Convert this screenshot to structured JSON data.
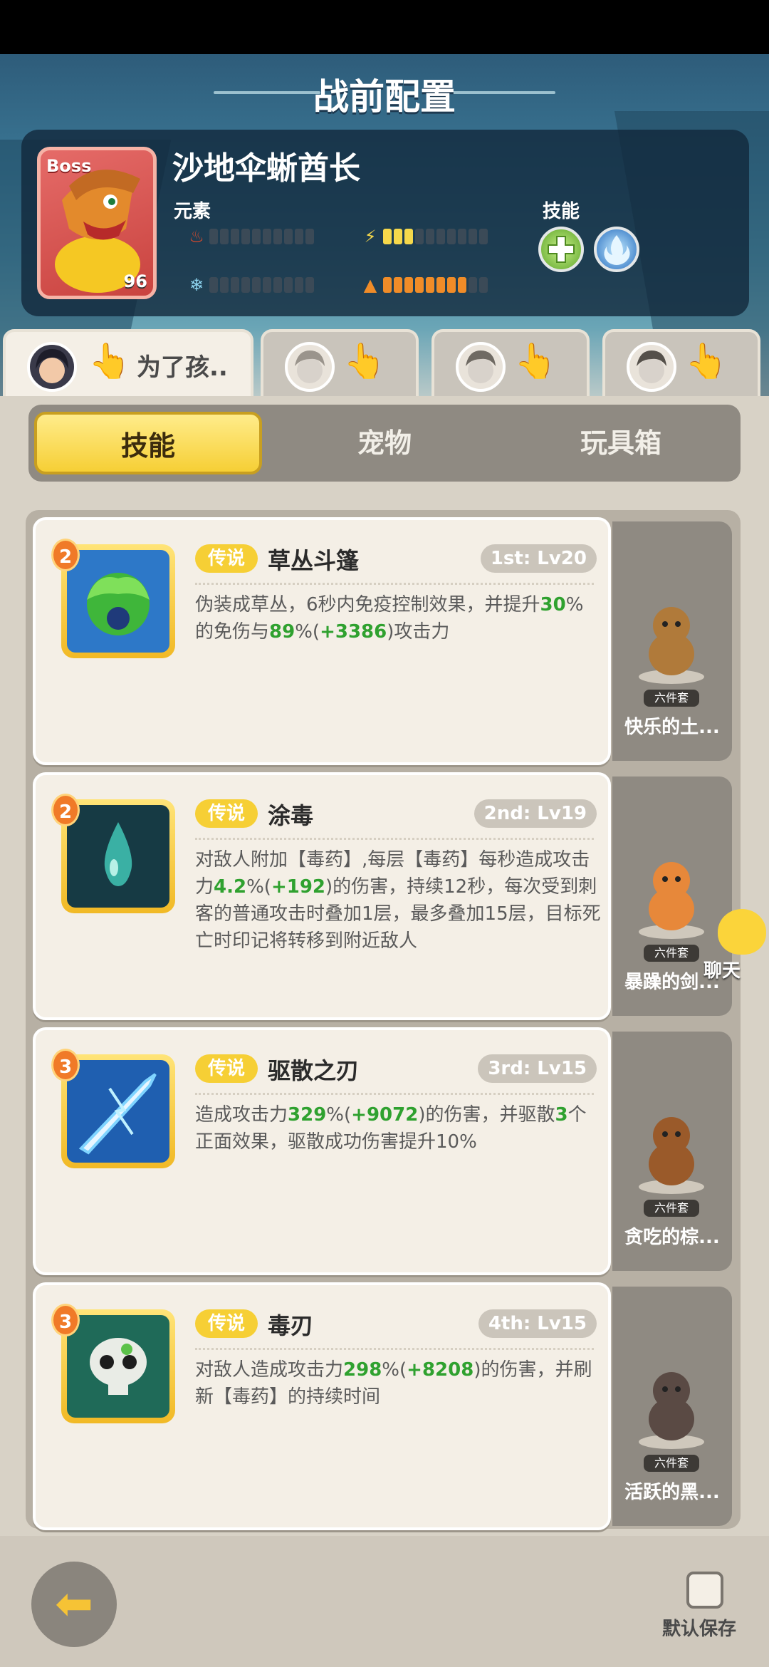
{
  "header": {
    "title": "战前配置"
  },
  "boss": {
    "tag": "Boss",
    "level": "96",
    "name": "沙地伞蜥酋长",
    "element_label": "元素",
    "skill_label": "技能",
    "elements": [
      {
        "icon": "fire-icon",
        "value": 0,
        "max": 10
      },
      {
        "icon": "lightning-icon",
        "value": 3,
        "max": 10
      },
      {
        "icon": "ice-icon",
        "value": 0,
        "max": 10
      },
      {
        "icon": "earth-icon",
        "value": 8,
        "max": 10
      }
    ],
    "skills": [
      {
        "icon": "heal-cross-icon",
        "color": "#7fc13a"
      },
      {
        "icon": "blue-flame-icon",
        "color": "#3b8fd6"
      }
    ]
  },
  "heroes": [
    {
      "name": "为了孩.."
    },
    {
      "name": ""
    },
    {
      "name": ""
    },
    {
      "name": ""
    }
  ],
  "segment": {
    "tabs": [
      "技能",
      "宠物",
      "玩具箱"
    ],
    "active": 0
  },
  "skills": [
    {
      "rank": "2",
      "badge": "传说",
      "name": "草丛斗篷",
      "level": "1st: Lv20",
      "desc_parts": [
        [
          "伪装成草丛，6秒内免疫控制效果，并提升",
          ""
        ],
        [
          "30",
          "g"
        ],
        [
          "%的免伤与",
          ""
        ],
        [
          "89",
          "g"
        ],
        [
          "%(",
          ""
        ],
        [
          "+3386",
          "g"
        ],
        [
          ")攻击力",
          ""
        ]
      ],
      "pet_name": "快乐的土...",
      "pet_tag": "六件套"
    },
    {
      "rank": "2",
      "badge": "传说",
      "name": "涂毒",
      "level": "2nd: Lv19",
      "desc_parts": [
        [
          "对敌人附加【毒药】,每层【毒药】每秒造成攻击力",
          ""
        ],
        [
          "4.2",
          "g"
        ],
        [
          "%(",
          ""
        ],
        [
          "+192",
          "g"
        ],
        [
          ")的伤害，持续12秒，每次受到刺客的普通攻击时叠加1层，最多叠加15层，目标死亡时印记将转移到附近敌人",
          ""
        ]
      ],
      "pet_name": "暴躁的剑...",
      "pet_tag": "六件套"
    },
    {
      "rank": "3",
      "badge": "传说",
      "name": "驱散之刃",
      "level": "3rd: Lv15",
      "desc_parts": [
        [
          "造成攻击力",
          ""
        ],
        [
          "329",
          "g"
        ],
        [
          "%(",
          ""
        ],
        [
          "+9072",
          "g"
        ],
        [
          ")的伤害，并驱散",
          ""
        ],
        [
          "3",
          "g"
        ],
        [
          "个正面效果，驱散成功伤害提升10%",
          ""
        ]
      ],
      "pet_name": "贪吃的棕...",
      "pet_tag": "六件套"
    },
    {
      "rank": "3",
      "badge": "传说",
      "name": "毒刃",
      "level": "4th: Lv15",
      "desc_parts": [
        [
          "对敌人造成攻击力",
          ""
        ],
        [
          "298",
          "g"
        ],
        [
          "%(",
          ""
        ],
        [
          "+8208",
          "g"
        ],
        [
          ")的伤害，并刷新【毒药】的持续时间",
          ""
        ]
      ],
      "pet_name": "活跃的黑...",
      "pet_tag": "六件套"
    }
  ],
  "chat": {
    "label": "聊天"
  },
  "footer": {
    "save_label": "默认保存"
  }
}
